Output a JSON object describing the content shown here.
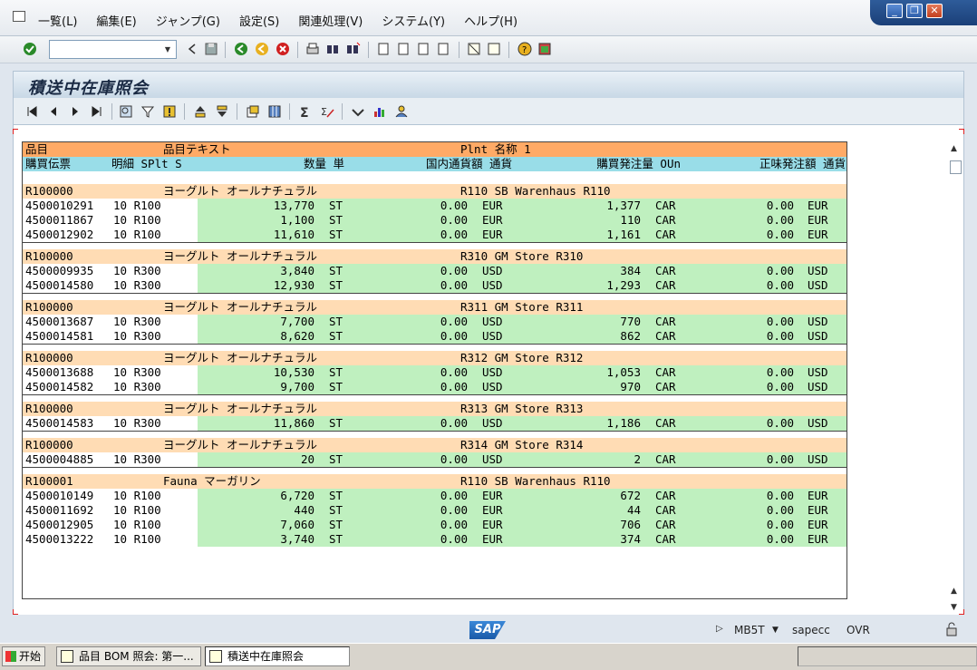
{
  "menu": [
    "一覧(L)",
    "編集(E)",
    "ジャンプ(G)",
    "設定(S)",
    "関連処理(V)",
    "システム(Y)",
    "ヘルプ(H)"
  ],
  "window_controls": [
    "minimize",
    "restore",
    "close"
  ],
  "command_field": {
    "value": "",
    "dropdown_icon": "chevron-down-icon"
  },
  "title": "積送中在庫照会",
  "header1": {
    "material": "品目",
    "text": "品目テキスト",
    "plant": "Plnt 名称 1"
  },
  "header2": {
    "po": "購買伝票",
    "item": "明細 SPlt S",
    "qty": "数量 単",
    "local_amt": "国内通貨額 通貨",
    "po_qty": "購買発注量 OUn",
    "net": "正味発注額 通貨"
  },
  "groups": [
    {
      "material": "R100000",
      "text": "ヨーグルト オールナチュラル",
      "plant": "R110 SB Warenhaus R110",
      "rows": [
        [
          "4500010291",
          "10 R100",
          "13,770",
          "ST",
          "0.00",
          "EUR",
          "1,377",
          "CAR",
          "0.00",
          "EUR"
        ],
        [
          "4500011867",
          "10 R100",
          "1,100",
          "ST",
          "0.00",
          "EUR",
          "110",
          "CAR",
          "0.00",
          "EUR"
        ],
        [
          "4500012902",
          "10 R100",
          "11,610",
          "ST",
          "0.00",
          "EUR",
          "1,161",
          "CAR",
          "0.00",
          "EUR"
        ]
      ]
    },
    {
      "material": "R100000",
      "text": "ヨーグルト オールナチュラル",
      "plant": "R310 GM Store R310",
      "rows": [
        [
          "4500009935",
          "10 R300",
          "3,840",
          "ST",
          "0.00",
          "USD",
          "384",
          "CAR",
          "0.00",
          "USD"
        ],
        [
          "4500014580",
          "10 R300",
          "12,930",
          "ST",
          "0.00",
          "USD",
          "1,293",
          "CAR",
          "0.00",
          "USD"
        ]
      ]
    },
    {
      "material": "R100000",
      "text": "ヨーグルト オールナチュラル",
      "plant": "R311 GM Store R311",
      "rows": [
        [
          "4500013687",
          "10 R300",
          "7,700",
          "ST",
          "0.00",
          "USD",
          "770",
          "CAR",
          "0.00",
          "USD"
        ],
        [
          "4500014581",
          "10 R300",
          "8,620",
          "ST",
          "0.00",
          "USD",
          "862",
          "CAR",
          "0.00",
          "USD"
        ]
      ]
    },
    {
      "material": "R100000",
      "text": "ヨーグルト オールナチュラル",
      "plant": "R312 GM Store R312",
      "rows": [
        [
          "4500013688",
          "10 R300",
          "10,530",
          "ST",
          "0.00",
          "USD",
          "1,053",
          "CAR",
          "0.00",
          "USD"
        ],
        [
          "4500014582",
          "10 R300",
          "9,700",
          "ST",
          "0.00",
          "USD",
          "970",
          "CAR",
          "0.00",
          "USD"
        ]
      ]
    },
    {
      "material": "R100000",
      "text": "ヨーグルト オールナチュラル",
      "plant": "R313 GM Store R313",
      "rows": [
        [
          "4500014583",
          "10 R300",
          "11,860",
          "ST",
          "0.00",
          "USD",
          "1,186",
          "CAR",
          "0.00",
          "USD"
        ]
      ]
    },
    {
      "material": "R100000",
      "text": "ヨーグルト オールナチュラル",
      "plant": "R314 GM Store R314",
      "rows": [
        [
          "4500004885",
          "10 R300",
          "20",
          "ST",
          "0.00",
          "USD",
          "2",
          "CAR",
          "0.00",
          "USD"
        ]
      ]
    },
    {
      "material": "R100001",
      "text": "Fauna マーガリン",
      "plant": "R110 SB Warenhaus R110",
      "rows": [
        [
          "4500010149",
          "10 R100",
          "6,720",
          "ST",
          "0.00",
          "EUR",
          "672",
          "CAR",
          "0.00",
          "EUR"
        ],
        [
          "4500011692",
          "10 R100",
          "440",
          "ST",
          "0.00",
          "EUR",
          "44",
          "CAR",
          "0.00",
          "EUR"
        ],
        [
          "4500012905",
          "10 R100",
          "7,060",
          "ST",
          "0.00",
          "EUR",
          "706",
          "CAR",
          "0.00",
          "EUR"
        ],
        [
          "4500013222",
          "10 R100",
          "3,740",
          "ST",
          "0.00",
          "EUR",
          "374",
          "CAR",
          "0.00",
          "EUR"
        ]
      ]
    }
  ],
  "status": {
    "logo": "SAP",
    "transaction": "MB5T",
    "server": "sapecc",
    "mode": "OVR"
  },
  "taskbar": {
    "start": "开始",
    "tasks": [
      "品目 BOM 照会: 第一...",
      "積送中在庫照会"
    ]
  }
}
